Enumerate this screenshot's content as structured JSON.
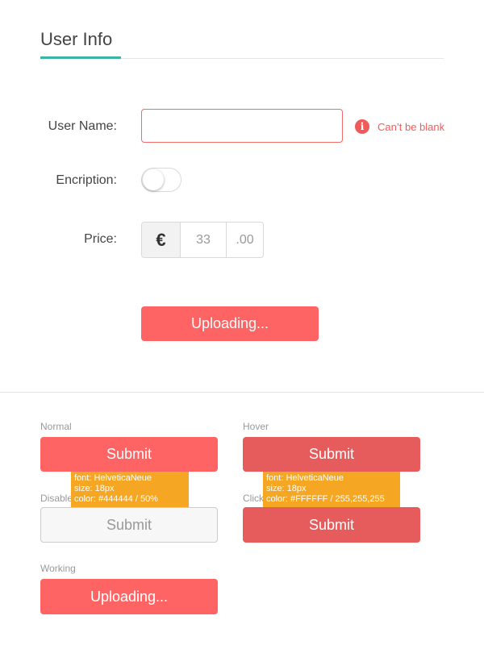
{
  "header": {
    "title": "User Info"
  },
  "form": {
    "user_name_label": "User Name:",
    "user_name_value": "",
    "error_icon": "info-icon",
    "error_icon_glyph": "i",
    "error_text": "Can’t be blank",
    "encryption_label": "Encription:",
    "encryption_on": false,
    "price_label": "Price:",
    "currency_symbol": "€",
    "price_amount": "33",
    "price_cents": ".00",
    "upload_button_label": "Uploading..."
  },
  "states": {
    "normal_label": "Normal",
    "hover_label": "Hover",
    "disabled_label": "Disable",
    "click_label": "Click",
    "working_label": "Working",
    "normal_button": "Submit",
    "hover_button": "Submit",
    "disabled_button": "Submit",
    "click_button": "Submit",
    "working_button": "Uploading..."
  },
  "annotations": {
    "disabled": {
      "font": "font: HelveticaNeue",
      "size": "size: 18px",
      "color": "color: #444444 / 50%"
    },
    "click": {
      "font": "font: HelveticaNeue",
      "size": "size: 18px",
      "color": "color: #FFFFFF / 255,255,255"
    }
  },
  "colors": {
    "accent": "#3bb3a5",
    "primary_button": "#ff6464",
    "hover_button": "#e65c5c",
    "error": "#f05a5a",
    "annotation": "#f5a623"
  }
}
